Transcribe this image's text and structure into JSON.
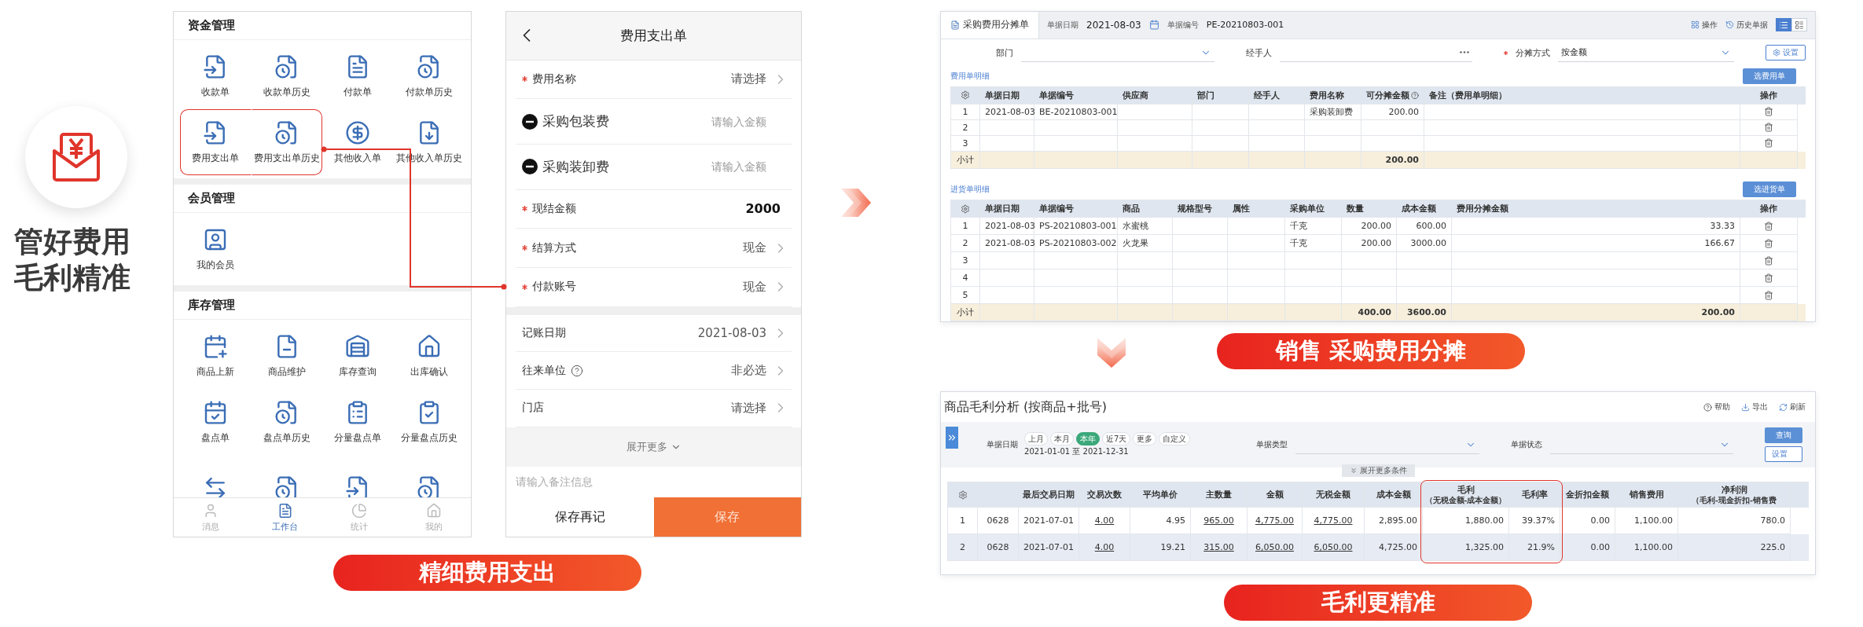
{
  "headline": {
    "lines": [
      "管好费用",
      "毛利精准"
    ]
  },
  "workbench": {
    "sections": [
      {
        "title": "资金管理",
        "items": [
          {
            "label": "收款单",
            "highlighted": false
          },
          {
            "label": "收款单历史",
            "highlighted": false
          },
          {
            "label": "付款单",
            "highlighted": false
          },
          {
            "label": "付款单历史",
            "highlighted": false
          },
          {
            "label": "费用支出单",
            "highlighted": true
          },
          {
            "label": "费用支出单历史",
            "highlighted": true
          },
          {
            "label": "其他收入单",
            "highlighted": false
          },
          {
            "label": "其他收入单历史",
            "highlighted": false
          }
        ]
      },
      {
        "title": "会员管理",
        "items": [
          {
            "label": "我的会员",
            "highlighted": false
          }
        ]
      },
      {
        "title": "库存管理",
        "items": [
          {
            "label": "商品上新",
            "highlighted": false
          },
          {
            "label": "商品维护",
            "highlighted": false
          },
          {
            "label": "库存查询",
            "highlighted": false
          },
          {
            "label": "出库确认",
            "highlighted": false
          },
          {
            "label": "盘点单",
            "highlighted": false
          },
          {
            "label": "盘点单历史",
            "highlighted": false
          },
          {
            "label": "分量盘点单",
            "highlighted": false
          },
          {
            "label": "分量盘点历史",
            "highlighted": false
          },
          {
            "highlighted": false
          },
          {
            "highlighted": false
          },
          {
            "highlighted": false
          },
          {
            "highlighted": false
          }
        ]
      }
    ],
    "tab_bar": [
      {
        "label": "消息",
        "selected": false
      },
      {
        "label": "工作台",
        "selected": true
      },
      {
        "label": "统计",
        "selected": false
      },
      {
        "label": "我的",
        "selected": false
      }
    ]
  },
  "expense_form": {
    "title": "费用支出单",
    "fields": [
      {
        "kind": "select",
        "label": "费用名称",
        "required": true,
        "help": false,
        "value": "请选择"
      },
      {
        "kind": "amount",
        "label": "采购包装费",
        "required": false,
        "help": false,
        "placeholder": "请输入金额"
      },
      {
        "kind": "amount",
        "label": "采购装卸费",
        "required": false,
        "help": false,
        "placeholder": "请输入金额"
      },
      {
        "kind": "value",
        "label": "现结金额",
        "required": true,
        "help": false,
        "value": "2000"
      },
      {
        "kind": "select",
        "label": "结算方式",
        "required": true,
        "help": false,
        "value": "现金"
      },
      {
        "kind": "select",
        "label": "付款账号",
        "required": true,
        "help": false,
        "value": "现金"
      }
    ],
    "extra_fields": [
      {
        "kind": "select",
        "label": "记账日期",
        "required": false,
        "help": false,
        "value": "2021-08-03"
      },
      {
        "kind": "select",
        "label": "往来单位",
        "required": false,
        "help": true,
        "value": "非必选"
      },
      {
        "kind": "select",
        "label": "门店",
        "required": false,
        "help": false,
        "value": "请选择"
      }
    ],
    "expand_label": "展开更多",
    "note_placeholder": "请输入备注信息",
    "buttons": [
      {
        "label": "保存再记",
        "kind": "secondary"
      },
      {
        "label": "保存",
        "kind": "primary"
      }
    ]
  },
  "caption_expense": "精细费用支出",
  "allocation": {
    "tab": "采购费用分摊单",
    "date_label": "单据日期",
    "date": "2021-08-03",
    "number_label": "单据编号",
    "number": "PE-20210803-001",
    "actions": [
      "操作",
      "历史单据"
    ],
    "views": [
      {
        "selected": true
      },
      {
        "selected": false
      }
    ],
    "filters": [
      {
        "kind": "dropdown",
        "label": "部门",
        "required": false
      },
      {
        "kind": "picker",
        "label": "经手人",
        "required": false
      },
      {
        "kind": "dropdown",
        "label": "分摊方式",
        "required": true,
        "value": "按金额"
      }
    ],
    "settings_button": "设置",
    "tables": [
      {
        "title": "费用单明细",
        "button": "选费用单",
        "columns": [
          {
            "kind": "settings"
          },
          {
            "label": "单据日期",
            "kind": "text"
          },
          {
            "label": "单据编号",
            "kind": "text"
          },
          {
            "label": "供应商",
            "kind": "text"
          },
          {
            "label": "部门",
            "kind": "text"
          },
          {
            "label": "经手人",
            "kind": "text"
          },
          {
            "label": "费用名称",
            "kind": "text"
          },
          {
            "label": "可分摊金额",
            "kind": "number",
            "help": true
          },
          {
            "label": "备注（费用单明细）",
            "kind": "text"
          },
          {
            "label": "操作",
            "kind": "action"
          }
        ],
        "rows": [
          [
            {
              "text": "1"
            },
            {
              "text": "2021-08-03"
            },
            {
              "text": "BE-20210803-001"
            },
            {},
            {},
            {},
            {
              "text": "采购装卸费"
            },
            {
              "text": "200.00"
            }
          ],
          [
            {
              "text": "2"
            }
          ],
          [
            {
              "text": "3"
            }
          ]
        ],
        "subtotal": {
          "label": "小计",
          "totals": [
            "200.00"
          ]
        }
      },
      {
        "title": "进货单明细",
        "button": "选进货单",
        "columns": [
          {
            "kind": "settings"
          },
          {
            "label": "单据日期",
            "kind": "text"
          },
          {
            "label": "单据编号",
            "kind": "text"
          },
          {
            "label": "商品",
            "kind": "text"
          },
          {
            "label": "规格型号",
            "kind": "text"
          },
          {
            "label": "属性",
            "kind": "text"
          },
          {
            "label": "采购单位",
            "kind": "text"
          },
          {
            "label": "数量",
            "kind": "number"
          },
          {
            "label": "成本金额",
            "kind": "number"
          },
          {
            "label": "费用分摊金额",
            "kind": "number"
          },
          {
            "label": "操作",
            "kind": "action"
          }
        ],
        "rows": [
          [
            {
              "text": "1"
            },
            {
              "text": "2021-08-03"
            },
            {
              "text": "PS-20210803-001"
            },
            {
              "text": "水蜜桃"
            },
            {},
            {},
            {
              "text": "千克"
            },
            {
              "text": "200.00"
            },
            {
              "text": "600.00"
            },
            {
              "text": "33.33"
            }
          ],
          [
            {
              "text": "2"
            },
            {
              "text": "2021-08-03"
            },
            {
              "text": "PS-20210803-002"
            },
            {
              "text": "火龙果"
            },
            {},
            {},
            {
              "text": "千克"
            },
            {
              "text": "200.00"
            },
            {
              "text": "3000.00"
            },
            {
              "text": "166.67"
            }
          ],
          [
            {
              "text": "3"
            }
          ],
          [
            {
              "text": "4"
            }
          ],
          [
            {
              "text": "5"
            }
          ]
        ],
        "subtotal": {
          "label": "小计",
          "totals": [
            "400.00",
            "3600.00",
            "200.00"
          ]
        }
      }
    ]
  },
  "caption_allocation": "销售 采购费用分摊",
  "profit": {
    "title": "商品毛利分析 (按商品+批号)",
    "tools": [
      "帮助",
      "导出",
      "刷新"
    ],
    "date_label": "单据日期",
    "periods": [
      {
        "label": "上月",
        "selected": false
      },
      {
        "label": "本月",
        "selected": false
      },
      {
        "label": "本年",
        "selected": true
      },
      {
        "label": "近7天",
        "selected": false
      },
      {
        "label": "更多",
        "selected": false
      },
      {
        "label": "自定义",
        "selected": false
      }
    ],
    "date_range": "2021-01-01 至 2021-12-31",
    "type_label": "单据类型",
    "status_label": "单据状态",
    "query_button": "查询",
    "settings_button": "设置",
    "expand_label": "展开更多条件",
    "columns": [
      {
        "kind": "settings",
        "highlighted": false
      },
      {
        "kind": "text",
        "highlighted": false
      },
      {
        "label": "最后交易日期",
        "kind": "text",
        "highlighted": false
      },
      {
        "label": "交易次数",
        "kind": "link",
        "highlighted": false
      },
      {
        "label": "平均单价",
        "kind": "number",
        "highlighted": false
      },
      {
        "label": "主数量",
        "kind": "link",
        "highlighted": false
      },
      {
        "label": "金额",
        "kind": "link",
        "highlighted": false
      },
      {
        "label": "无税金额",
        "kind": "link",
        "highlighted": false
      },
      {
        "label": "成本金额",
        "kind": "number",
        "highlighted": false
      },
      {
        "label": "毛利",
        "sublabel": "（无税金额-成本金额）",
        "kind": "number",
        "highlighted": true
      },
      {
        "label": "毛利率",
        "kind": "number",
        "highlighted": true
      },
      {
        "label": "金折扣金额",
        "kind": "number",
        "highlighted": false
      },
      {
        "label": "销售费用",
        "kind": "number",
        "highlighted": false
      },
      {
        "label": "净利润",
        "sublabel": "（毛利-现金折扣-销售费",
        "kind": "number",
        "highlighted": false
      }
    ],
    "rows": [
      {
        "selected": false,
        "cells": [
          "1",
          "0628",
          "2021-07-01",
          "4.00",
          "4.95",
          "965.00",
          "4,775.00",
          "4,775.00",
          "2,895.00",
          "1,880.00",
          "39.37%",
          "0.00",
          "1,100.00",
          "780.0"
        ]
      },
      {
        "selected": true,
        "cells": [
          "2",
          "0628",
          "2021-07-01",
          "4.00",
          "19.21",
          "315.00",
          "6,050.00",
          "6,050.00",
          "4,725.00",
          "1,325.00",
          "21.9%",
          "0.00",
          "1,100.00",
          "225.0"
        ]
      }
    ]
  },
  "caption_profit": "毛利更精准"
}
